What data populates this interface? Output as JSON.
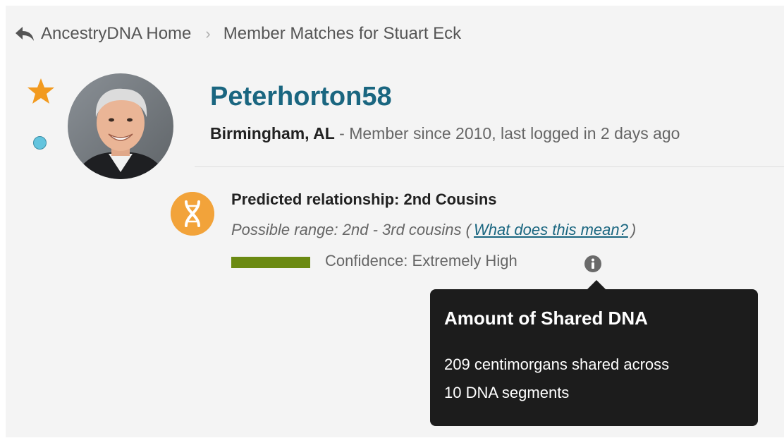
{
  "breadcrumb": {
    "home_label": "AncestryDNA Home",
    "current_label": "Member Matches for Stuart Eck",
    "back_icon": "reply-arrow-icon",
    "separator_icon": "chevron-right-icon"
  },
  "match": {
    "starred": true,
    "star_icon": "star-icon",
    "group_dot_color": "#63c4de",
    "username": "Peterhorton58",
    "location": "Birmingham, AL",
    "member_info": " - Member since 2010, last logged in 2 days ago"
  },
  "relationship": {
    "icon": "dna-helix-icon",
    "icon_color": "#f2a33a",
    "predicted": "Predicted relationship: 2nd Cousins",
    "range_prefix": "Possible range: 2nd - 3rd cousins (",
    "range_link": "What does this mean?",
    "range_suffix": ")",
    "confidence_label": "Confidence: Extremely High",
    "confidence_level": 1.0,
    "confidence_color": "#6b8a12",
    "info_icon": "info-icon"
  },
  "tooltip": {
    "title": "Amount of Shared DNA",
    "line1": "209 centimorgans shared across",
    "line2": "10 DNA segments"
  }
}
